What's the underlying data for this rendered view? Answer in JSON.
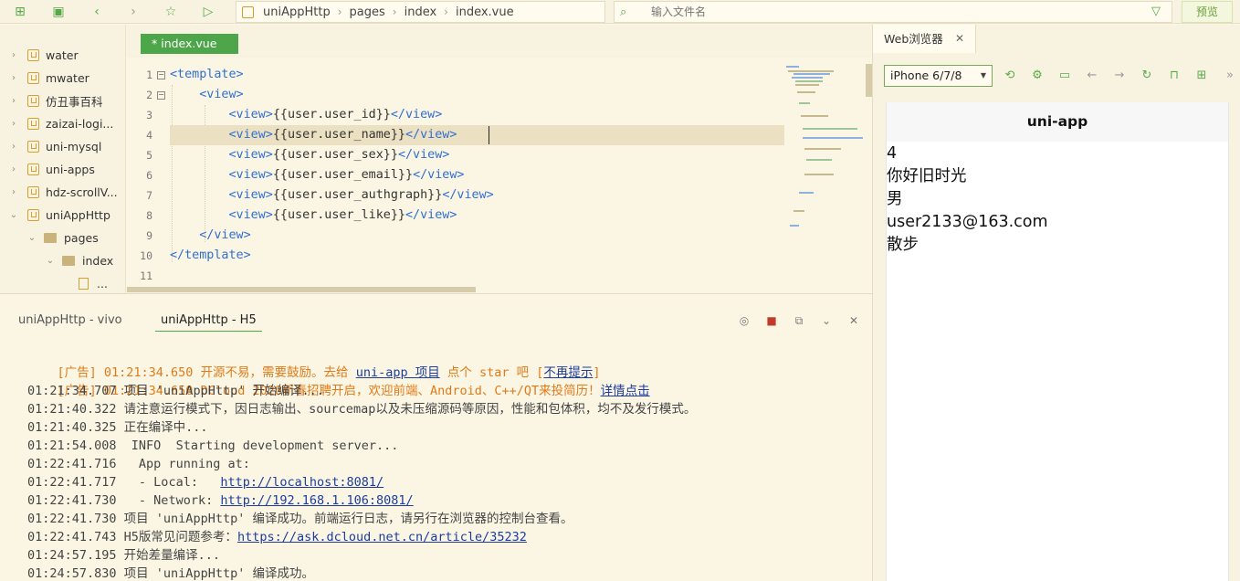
{
  "toolbar": {
    "icons": [
      "new-file-icon",
      "save-icon",
      "back-icon",
      "forward-icon",
      "star-icon",
      "run-icon"
    ]
  },
  "breadcrumb": [
    "uniAppHttp",
    "pages",
    "index",
    "index.vue"
  ],
  "file_search": {
    "placeholder": "输入文件名"
  },
  "preview_button": "预览",
  "sidebar": {
    "items": [
      {
        "label": "water"
      },
      {
        "label": "mwater"
      },
      {
        "label": "仿丑事百科"
      },
      {
        "label": "zaizai-logi..."
      },
      {
        "label": "uni-mysql"
      },
      {
        "label": "uni-apps"
      },
      {
        "label": "hdz-scrollV..."
      },
      {
        "label": "uniAppHttp"
      },
      {
        "label": "pages"
      },
      {
        "label": "index"
      },
      {
        "label": "..."
      }
    ]
  },
  "editor": {
    "tab_label": "* index.vue",
    "lines": [
      {
        "n": "1",
        "open": "<template>",
        "text": "",
        "close": ""
      },
      {
        "n": "2",
        "open": "<view>",
        "text": "",
        "close": ""
      },
      {
        "n": "3",
        "open": "<view>",
        "text": "{{user.user_id}}",
        "close": "</view>"
      },
      {
        "n": "4",
        "open": "<view>",
        "text": "{{user.user_name}}",
        "close": "</view>"
      },
      {
        "n": "5",
        "open": "<view>",
        "text": "{{user.user_sex}}",
        "close": "</view>"
      },
      {
        "n": "6",
        "open": "<view>",
        "text": "{{user.user_email}}",
        "close": "</view>"
      },
      {
        "n": "7",
        "open": "<view>",
        "text": "{{user.user_authgraph}}",
        "close": "</view>"
      },
      {
        "n": "8",
        "open": "<view>",
        "text": "{{user.user_like}}",
        "close": "</view>"
      },
      {
        "n": "9",
        "open": "",
        "text": "",
        "close": "</view>"
      },
      {
        "n": "10",
        "open": "",
        "text": "",
        "close": "</template>"
      },
      {
        "n": "11",
        "open": "",
        "text": "",
        "close": ""
      }
    ]
  },
  "console": {
    "tabs": [
      "uniAppHttp - vivo",
      "uniAppHttp - H5"
    ],
    "logs": [
      {
        "time": "[广告] 01:21:34.650 ",
        "msg": "开源不易，需要鼓励。去给 ",
        "link": "uni-app 项目",
        "tail": " 点个 star 吧 [",
        "link2": "不再提示",
        "tail2": "]"
      },
      {
        "time": "[广告] 01:21:34.650 ",
        "msg": "DCloud 2020新春招聘开启，欢迎前端、Android、C++/QT来投简历！",
        "link": "详情点击",
        "tail": "",
        "link2": "",
        "tail2": ""
      },
      {
        "time": "01:21:34.707 ",
        "msg": "项目 'uniAppHttp' 开始编译...",
        "link": "",
        "tail": "",
        "link2": "",
        "tail2": ""
      },
      {
        "time": "01:21:40.322 ",
        "msg": "请注意运行模式下，因日志输出、sourcemap以及未压缩源码等原因，性能和包体积，均不及发行模式。",
        "link": "",
        "tail": "",
        "link2": "",
        "tail2": ""
      },
      {
        "time": "01:21:40.325 ",
        "msg": "正在编译中...",
        "link": "",
        "tail": "",
        "link2": "",
        "tail2": ""
      },
      {
        "time": "01:21:54.008 ",
        "msg": " INFO  Starting development server...",
        "link": "",
        "tail": "",
        "link2": "",
        "tail2": ""
      },
      {
        "time": "01:22:41.716 ",
        "msg": "  App running at:",
        "link": "",
        "tail": "",
        "link2": "",
        "tail2": ""
      },
      {
        "time": "01:22:41.717 ",
        "msg": "  - Local:   ",
        "link": "http://localhost:8081/",
        "tail": "",
        "link2": "",
        "tail2": ""
      },
      {
        "time": "01:22:41.730 ",
        "msg": "  - Network: ",
        "link": "http://192.168.1.106:8081/",
        "tail": "",
        "link2": "",
        "tail2": ""
      },
      {
        "time": "01:22:41.730 ",
        "msg": "项目 'uniAppHttp' 编译成功。前端运行日志，请另行在浏览器的控制台查看。",
        "link": "",
        "tail": "",
        "link2": "",
        "tail2": ""
      },
      {
        "time": "01:22:41.743 ",
        "msg": "H5版常见问题参考：",
        "link": "https://ask.dcloud.net.cn/article/35232",
        "tail": "",
        "link2": "",
        "tail2": ""
      },
      {
        "time": "01:24:57.195 ",
        "msg": "开始差量编译...",
        "link": "",
        "tail": "",
        "link2": "",
        "tail2": ""
      },
      {
        "time": "01:24:57.830 ",
        "msg": "项目 'uniAppHttp' 编译成功。",
        "link": "",
        "tail": "",
        "link2": "",
        "tail2": ""
      }
    ]
  },
  "web_browser": {
    "tab_label": "Web浏览器",
    "device": "iPhone 6/7/8",
    "page_title": "uni-app",
    "user": {
      "user_id": "4",
      "user_name": "你好旧时光",
      "user_sex": "男",
      "user_email": "user2133@163.com",
      "user_like": "散步"
    }
  },
  "colors": {
    "accent": "#4ea64a",
    "tag": "#2e6fd4",
    "ad": "#e07a18",
    "link": "#1b3c9e",
    "bg": "#fbf6e4"
  }
}
